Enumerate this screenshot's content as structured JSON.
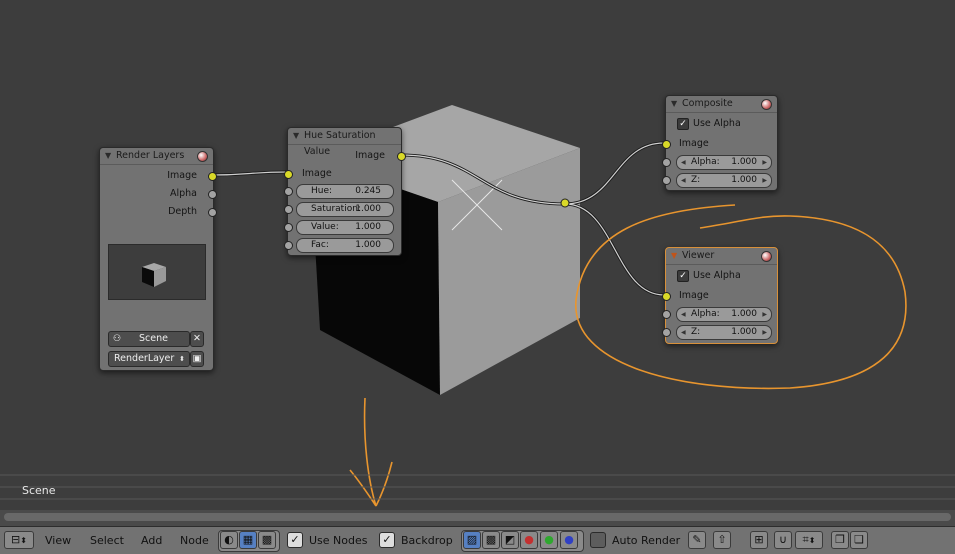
{
  "render_layers": {
    "title": "Render Layers",
    "outputs": [
      "Image",
      "Alpha",
      "Depth"
    ],
    "scene_select": "Scene",
    "layer_select": "RenderLayer"
  },
  "hue_sat": {
    "title": "Hue Saturation Value",
    "output": "Image",
    "input": "Image",
    "fields": [
      {
        "label": "Hue:",
        "value": "0.245"
      },
      {
        "label": "Saturation:",
        "value": "1.000"
      },
      {
        "label": "Value:",
        "value": "1.000"
      },
      {
        "label": "Fac:",
        "value": "1.000"
      }
    ]
  },
  "composite": {
    "title": "Composite",
    "use_alpha": "Use Alpha",
    "input": "Image",
    "alpha": {
      "label": "Alpha:",
      "value": "1.000"
    },
    "z": {
      "label": "Z:",
      "value": "1.000"
    }
  },
  "viewer": {
    "title": "Viewer",
    "use_alpha": "Use Alpha",
    "input": "Image",
    "alpha": {
      "label": "Alpha:",
      "value": "1.000"
    },
    "z": {
      "label": "Z:",
      "value": "1.000"
    }
  },
  "timeline": {
    "scene_label": "Scene"
  },
  "header": {
    "menus": [
      "View",
      "Select",
      "Add",
      "Node"
    ],
    "use_nodes": "Use Nodes",
    "backdrop": "Backdrop",
    "auto_render": "Auto Render"
  },
  "colors": {
    "annotation": "#e8952e",
    "socket_image": "#d9d928",
    "socket_value": "#a3a3a3",
    "active_outline": "#d8903a"
  }
}
